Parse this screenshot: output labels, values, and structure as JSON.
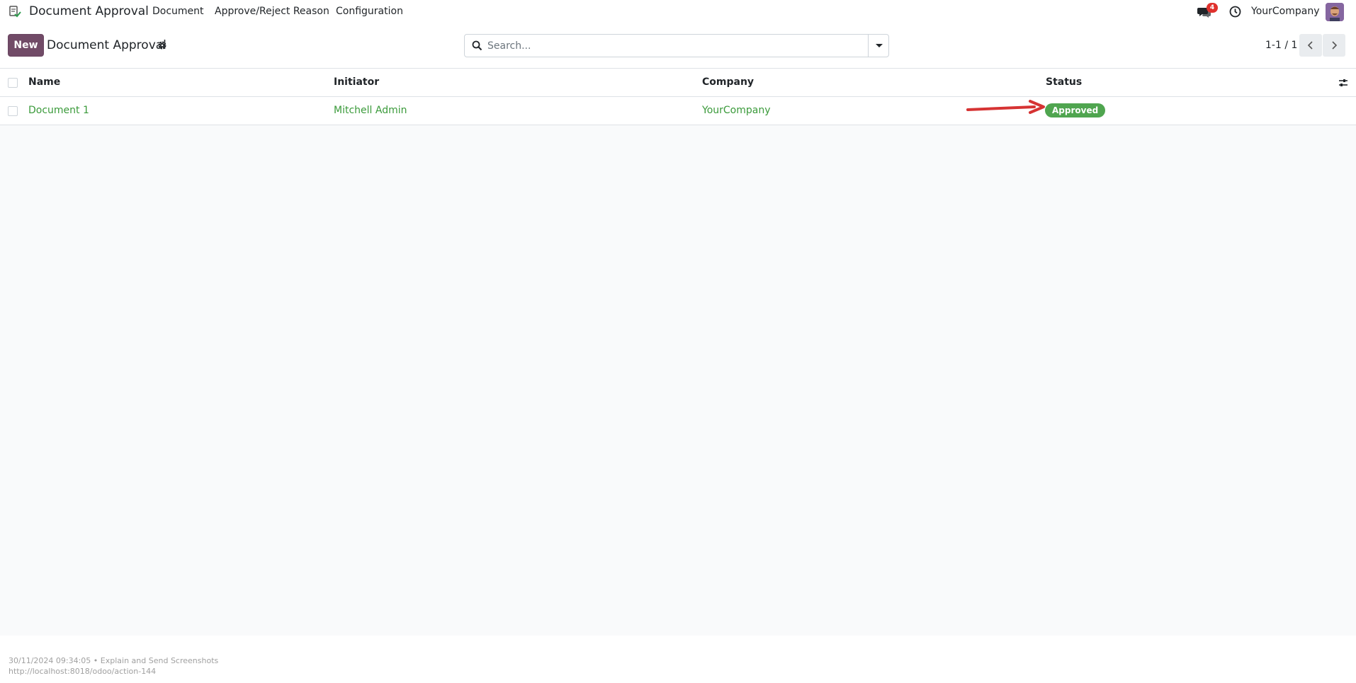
{
  "navbar": {
    "app_name": "Document Approval",
    "menu": [
      "Document",
      "Approve/Reject Reason",
      "Configuration"
    ],
    "chat_count": "4",
    "company": "YourCompany"
  },
  "control_panel": {
    "new_label": "New",
    "title": "Document Approval",
    "search_placeholder": "Search...",
    "pager": "1-1 / 1"
  },
  "list": {
    "columns": [
      "Name",
      "Initiator",
      "Company",
      "Status"
    ],
    "rows": [
      {
        "name": "Document 1",
        "initiator": "Mitchell Admin",
        "company": "YourCompany",
        "status": "Approved"
      }
    ]
  },
  "footer": {
    "line1": "30/11/2024 09:34:05 • Explain and Send Screenshots",
    "line2": "http://localhost:8018/odoo/action-144"
  },
  "colors": {
    "brand": "#714b67",
    "link": "#3a9a3a",
    "status_approved": "#4fa54f",
    "badge": "#e0312d",
    "annotation_arrow": "#d63333"
  }
}
